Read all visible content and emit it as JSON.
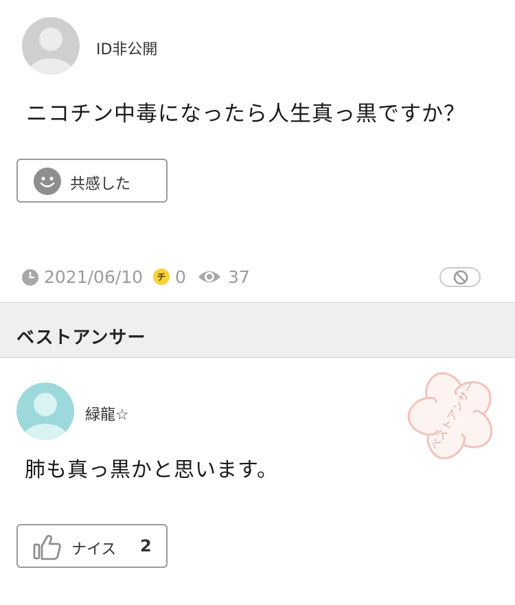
{
  "question": {
    "username": "ID非公開",
    "text": "ニコチン中毒になったら人生真っ黒ですか？",
    "empathy_label": "共感した",
    "date": "2021/06/10",
    "chip_count": "0",
    "chip_glyph": "チ",
    "view_count": "37"
  },
  "best_answer": {
    "header": "ベストアンサー",
    "username": "緑龍☆",
    "text": "肺も真っ黒かと思います。",
    "nice_label": "ナイス",
    "nice_count": "2",
    "stamp_text": "ベストアンサー"
  },
  "colors": {
    "avatar_gray": "#cccccc",
    "avatar_teal": "#9dd9da",
    "chip_yellow": "#f6d23c",
    "meta_gray": "#9b9b9b",
    "stamp_pink": "#f3cbc2"
  },
  "icons": {
    "clock": "clock-icon",
    "chip": "chiebukuro-coin-icon",
    "eye": "eye-icon",
    "block": "block-icon",
    "smile": "smile-icon",
    "thumb": "thumbs-up-icon"
  }
}
